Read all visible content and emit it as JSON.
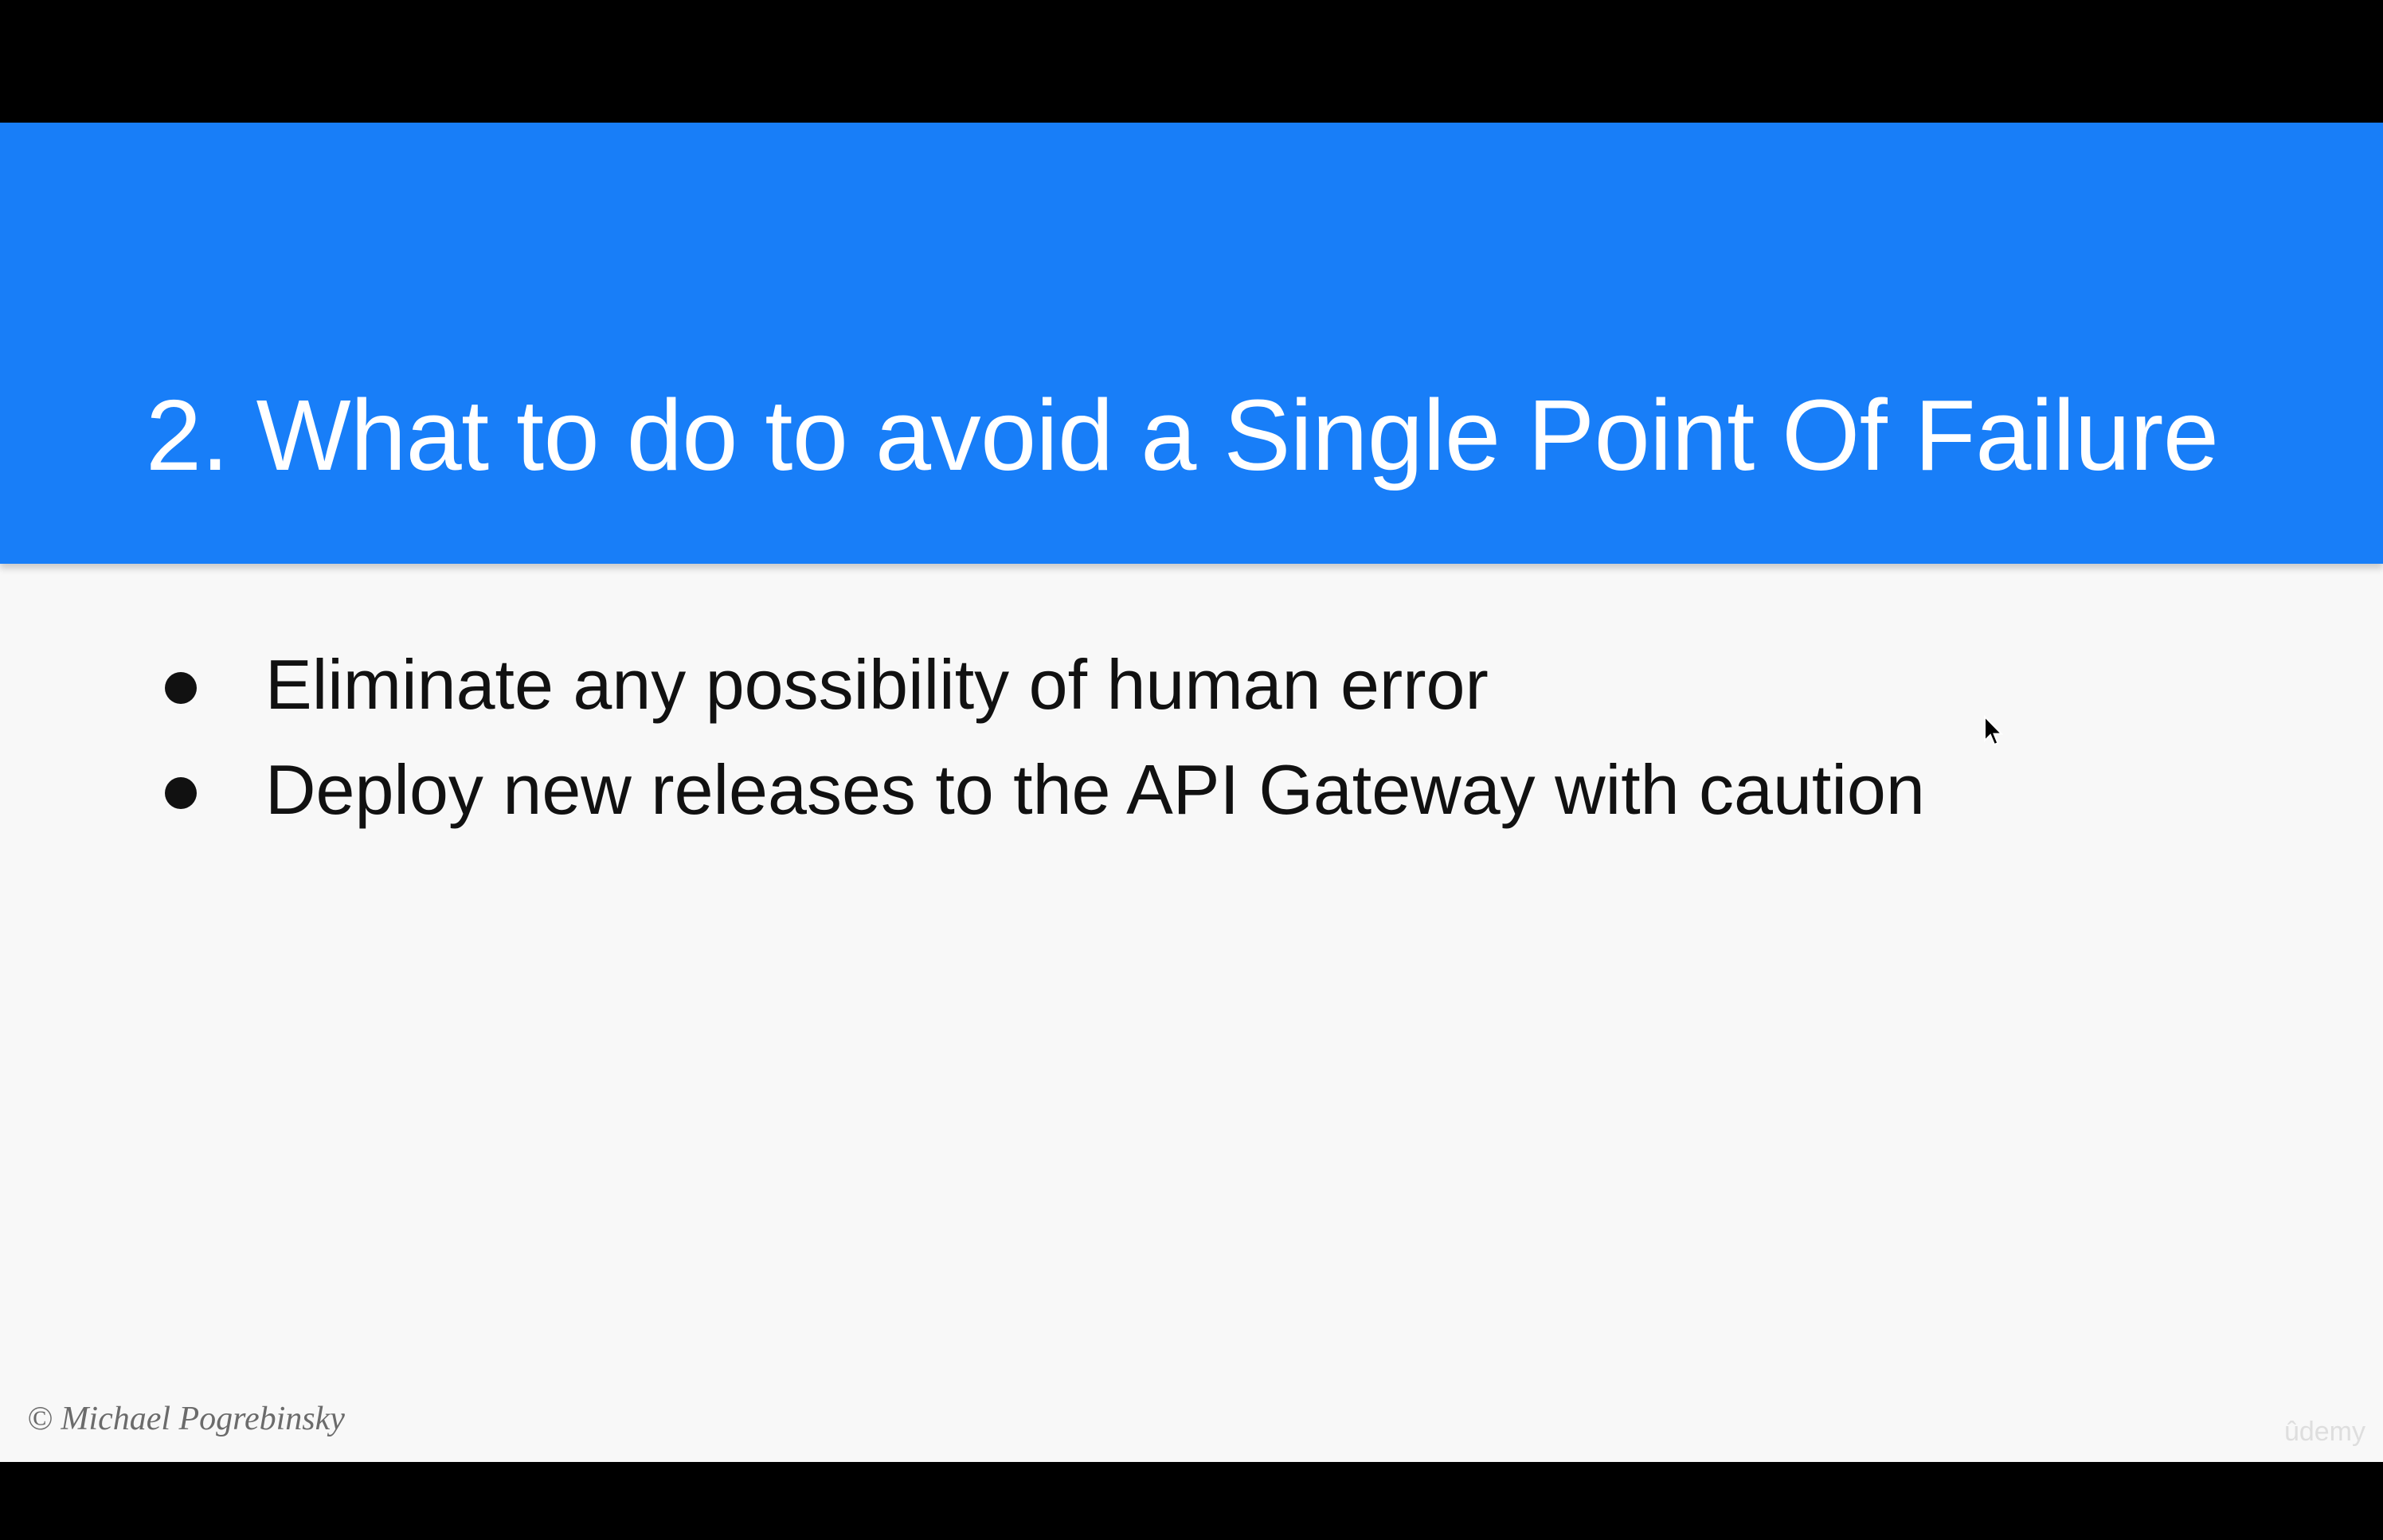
{
  "slide": {
    "title": "2. What to do to avoid a Single Point Of Failure",
    "bullets": [
      "Eliminate any possibility of human error",
      "Deploy new releases to the API Gateway with caution"
    ],
    "copyright": "© Michael Pogrebinsky",
    "watermark": "ûdemy"
  },
  "colors": {
    "header_band": "#187ef8",
    "slide_background": "#f8f8f8",
    "letterbox": "#000000",
    "title_text": "#ffffff",
    "body_text": "#111111"
  },
  "icons": {
    "bullet": "filled-circle",
    "cursor": "mouse-pointer-arrow"
  }
}
